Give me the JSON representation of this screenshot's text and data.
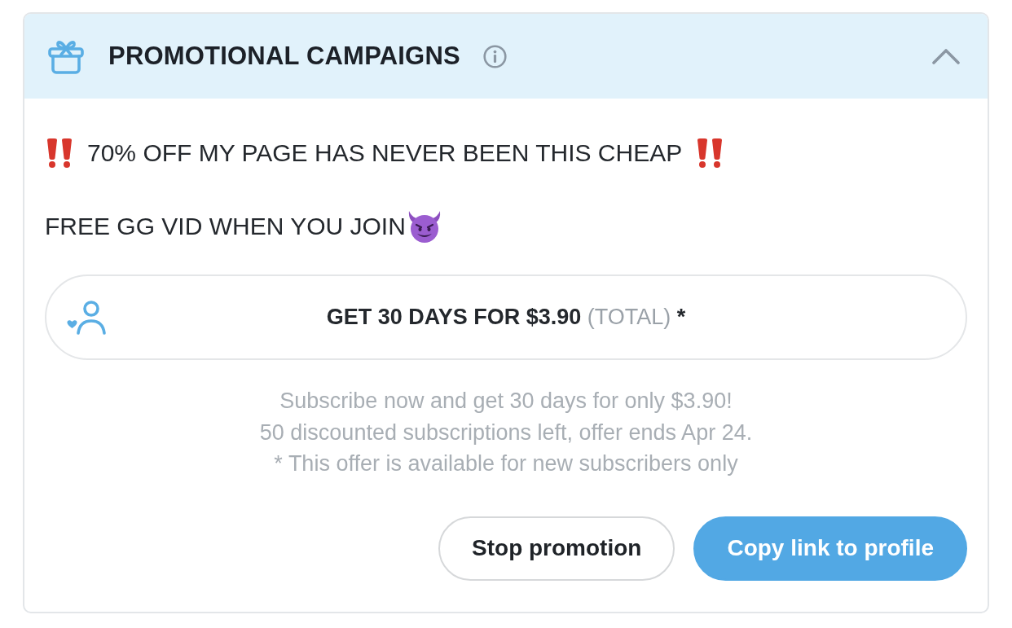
{
  "panel": {
    "title": "PROMOTIONAL CAMPAIGNS",
    "expanded": true
  },
  "campaign": {
    "headline": "70% OFF MY PAGE HAS NEVER BEEN THIS CHEAP",
    "tagline": "FREE GG VID WHEN YOU JOIN",
    "offer": {
      "main": "GET 30 DAYS FOR $3.90",
      "note": "(TOTAL)",
      "mark": "*"
    },
    "details": [
      "Subscribe now and get 30 days for only $3.90!",
      "50 discounted subscriptions left, offer ends Apr 24.",
      "* This offer is available for new subscribers only"
    ]
  },
  "buttons": [
    {
      "label": "Stop promotion",
      "kind": "outline"
    },
    {
      "label": "Copy link to profile",
      "kind": "primary"
    }
  ]
}
